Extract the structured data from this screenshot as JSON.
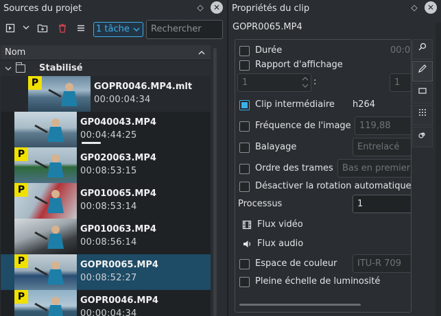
{
  "left_panel": {
    "title": "Sources du projet",
    "float_icon": "◇",
    "close_icon": "✕",
    "toolbar": {
      "task_combo": "1 tâche",
      "search_placeholder": "Rechercher"
    },
    "column_header": "Nom",
    "folder": {
      "name": "Stabilisé"
    },
    "clips": [
      {
        "name": "GOPR0046.MP4.mlt",
        "duration": "00:00:04:34",
        "proxy": "P",
        "indent": true
      },
      {
        "name": "GP040043.MP4",
        "duration": "00:04:44:25",
        "proxy": "",
        "progress": 0.6
      },
      {
        "name": "GP020063.MP4",
        "duration": "00:08:53:15",
        "proxy": "P"
      },
      {
        "name": "GP010065.MP4",
        "duration": "00:08:53:14",
        "proxy": "P"
      },
      {
        "name": "GP010063.MP4",
        "duration": "00:08:56:14",
        "proxy": ""
      },
      {
        "name": "GOPR0065.MP4",
        "duration": "00:08:52:27",
        "proxy": "P",
        "selected": true
      },
      {
        "name": "GOPR0046.MP4",
        "duration": "00:00:04:34",
        "proxy": "P"
      }
    ]
  },
  "right_panel": {
    "title": "Propriétés du clip",
    "float_icon": "◇",
    "close_icon": "✕",
    "clip_name": "GOPR0065.MP4",
    "properties": {
      "duration_label": "Durée",
      "duration_value": "00:0",
      "aspect_label": "Rapport d'affichage",
      "aspect_num": "1",
      "aspect_sep": ":",
      "aspect_den": "1",
      "intermediate_label": "Clip intermédiaire",
      "intermediate_value": "h264",
      "framerate_label": "Fréquence de l'image",
      "framerate_value": "119,88",
      "scan_label": "Balayage",
      "scan_value": "Entrelacé",
      "field_order_label": "Ordre des trames",
      "field_order_value": "Bas en premier",
      "disable_rotation_label": "Désactiver la rotation automatique",
      "threads_label": "Processus",
      "threads_value": "1",
      "video_stream_label": "Flux vidéo",
      "audio_stream_label": "Flux audio",
      "colorspace_label": "Espace de couleur",
      "colorspace_value": "ITU-R 709",
      "full_luma_label": "Pleine échelle de luminosité"
    }
  },
  "colors": {
    "accent": "#3daee9",
    "selection": "#1e4b66",
    "proxy_badge": "#f0e000",
    "background": "#2a2e32"
  }
}
